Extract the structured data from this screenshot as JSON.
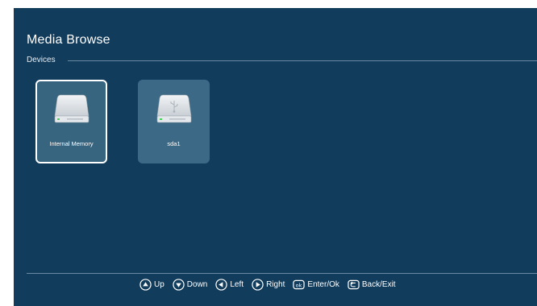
{
  "screen": {
    "title": "Media Browse",
    "section_label": "Devices"
  },
  "devices": [
    {
      "label": "Internal Memory",
      "icon": "hard-drive-icon",
      "selected": true
    },
    {
      "label": "sda1",
      "icon": "usb-drive-icon",
      "selected": false
    }
  ],
  "hints": {
    "up": "Up",
    "down": "Down",
    "left": "Left",
    "right": "Right",
    "ok": "Enter/Ok",
    "back": "Back/Exit",
    "ok_glyph": "ok"
  },
  "colors": {
    "background": "#123c5c",
    "tile": "#3c6a86",
    "selected_border": "#ffffff"
  }
}
